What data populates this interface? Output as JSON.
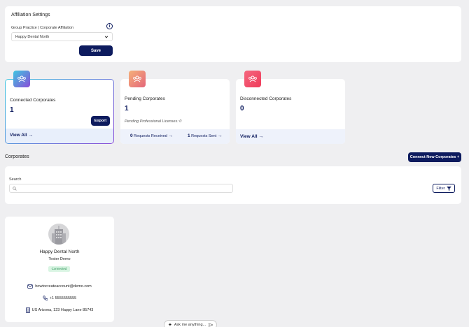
{
  "affiliation": {
    "title": "Affiliation Settings",
    "field_label": "Group Practice | Corporate Affiliation",
    "selected": "Happy Dental North",
    "save_label": "Save"
  },
  "tiles": {
    "connected": {
      "title": "Connected Corporates",
      "count": "1",
      "export_label": "Export",
      "view_all": "View All"
    },
    "pending": {
      "title": "Pending Corporates",
      "count": "1",
      "licenses_label": "Pending Professional Licenses:",
      "licenses_value": "0",
      "received_count": "0",
      "received_label": "Requests Received",
      "sent_count": "1",
      "sent_label": "Requests Sent"
    },
    "disconnected": {
      "title": "Disconnected Corporates",
      "count": "0",
      "view_all": "View All"
    }
  },
  "corporates": {
    "section_title": "Corporates",
    "connect_label": "Connect New Corporates +",
    "search_label": "Search",
    "search_placeholder": "",
    "filter_label": "Filter"
  },
  "corporate_card": {
    "name": "Happy Dental North",
    "contact": "Tester Demo",
    "status": "Connected",
    "email": "howtocreateaccount@demo.com",
    "phone": "+1 5555555555",
    "address": "US Arizona, 123 Happy Lane 85743"
  },
  "chat": {
    "placeholder": "Ask me anything..."
  },
  "colors": {
    "navy": "#0d1b5e",
    "status_bg": "#d9f5e3",
    "status_text": "#1f8a4c"
  }
}
